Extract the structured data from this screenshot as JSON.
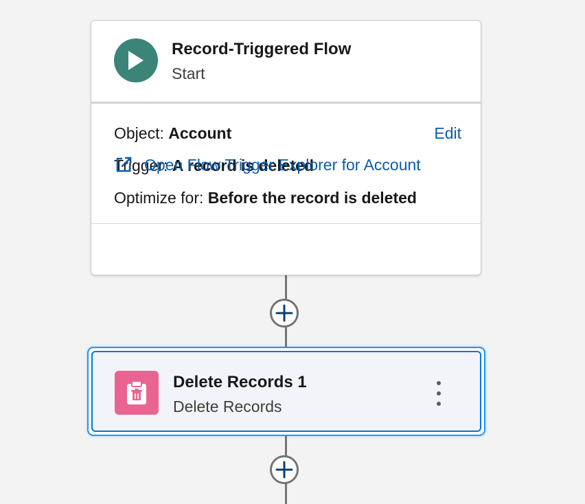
{
  "start_node": {
    "title": "Record-Triggered Flow",
    "subtitle": "Start",
    "icon": "play-icon",
    "object_label": "Object:",
    "object_value": "Account",
    "edit_label": "Edit",
    "trigger_label": "Trigger:",
    "trigger_value": "A record is deleted",
    "optimize_label": "Optimize for:",
    "optimize_value": "Before the record is deleted",
    "explorer_link": "Open Flow Trigger Explorer for Account",
    "accent_color": "#3a8478",
    "link_color": "#0b5cab"
  },
  "connectors": {
    "add_icon": "plus-icon"
  },
  "delete_node": {
    "title": "Delete Records 1",
    "subtitle": "Delete Records",
    "icon": "delete-records-icon",
    "icon_color": "#ea6491",
    "selected_border_color": "#1b96ff",
    "menu_icon": "more-vertical-icon"
  }
}
